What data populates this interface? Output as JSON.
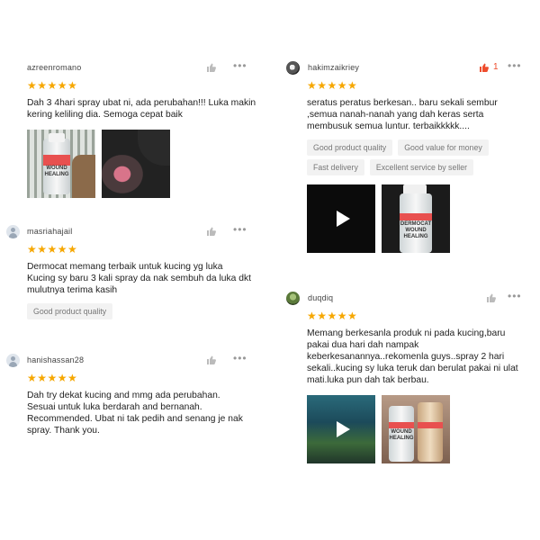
{
  "reviews": [
    {
      "username": "azreenromano",
      "stars": "★★★★★",
      "text": "Dah 3 4hari spray ubat ni, ada perubahan!!! Luka makin kering keliling dia. Semoga cepat baik",
      "media_label": "WOUND\nHEALING"
    },
    {
      "username": "masriahajail",
      "stars": "★★★★★",
      "text": "Dermocat memang terbaik untuk kucing yg luka Kucing sy baru 3 kali spray da nak sembuh da luka dkt mulutnya terima kasih",
      "tags": [
        "Good product quality"
      ]
    },
    {
      "username": "hanishassan28",
      "stars": "★★★★★",
      "text": "Dah try dekat kucing and mmg ada perubahan. Sesuai untuk luka berdarah and bernanah. Recommended. Ubat ni tak pedih and senang je nak spray. Thank you."
    },
    {
      "username": "hakimzaikriey",
      "stars": "★★★★★",
      "like_count": "1",
      "text": "seratus peratus berkesan.. baru sekali sembur ,semua nanah-nanah yang dah keras serta membusuk semua luntur. terbaikkkkk....",
      "tags": [
        "Good product quality",
        "Good value for money",
        "Fast delivery",
        "Excellent service by seller"
      ],
      "media_label": "DERMOCAT\nWOUND\nHEALING"
    },
    {
      "username": "duqdiq",
      "stars": "★★★★★",
      "text": "Memang berkesanla produk ni pada kucing,baru pakai dua hari dah nampak keberkesanannya..rekomenla guys..spray 2 hari sekali..kucing sy luka teruk dan berulat pakai ni ulat mati.luka pun dah tak berbau.",
      "media_label": "WOUND\nHEALING"
    }
  ],
  "colors": {
    "star": "#f6a700",
    "liked": "#ee4d2d",
    "tag_bg": "#f2f2f2"
  },
  "icons": {
    "like": "thumbs-up-icon",
    "more": "more-dots-icon",
    "play": "play-icon"
  }
}
